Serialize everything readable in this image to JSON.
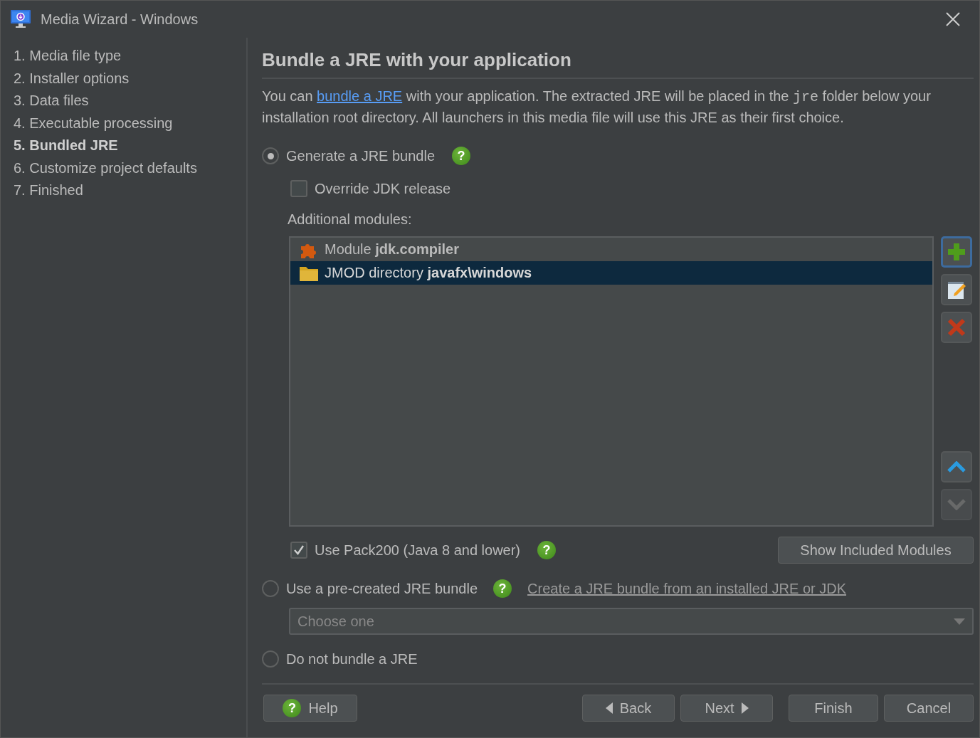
{
  "window": {
    "title": "Media Wizard - Windows"
  },
  "steps": [
    {
      "label": "1. Media file type",
      "selected": false
    },
    {
      "label": "2. Installer options",
      "selected": false
    },
    {
      "label": "3. Data files",
      "selected": false
    },
    {
      "label": "4. Executable processing",
      "selected": false
    },
    {
      "label": "5. Bundled JRE",
      "selected": true
    },
    {
      "label": "6. Customize project defaults",
      "selected": false
    },
    {
      "label": "7. Finished",
      "selected": false
    }
  ],
  "page": {
    "heading": "Bundle a JRE with your application",
    "intro": [
      {
        "kind": "text",
        "text": "You can "
      },
      {
        "kind": "link",
        "text": "bundle a JRE"
      },
      {
        "kind": "text",
        "text": " with your application. The extracted JRE will be placed in the "
      },
      {
        "kind": "code",
        "text": "jre"
      },
      {
        "kind": "text",
        "text": " folder below your installation root directory. All launchers in this media file will use this JRE as their first choice."
      }
    ],
    "generate": {
      "label": "Generate a JRE bundle",
      "selected": true,
      "help": "?"
    },
    "override": {
      "label": "Override JDK release",
      "checked": false
    },
    "modules_label": "Additional modules:",
    "modules": [
      {
        "kind": "module",
        "text": "Module **jdk.compiler**",
        "selected": false
      },
      {
        "kind": "jmod",
        "text": "JMOD directory **javafx\\windows**",
        "selected": true
      }
    ],
    "tool_buttons": [
      {
        "kind": "add",
        "focused": true,
        "disabled": false
      },
      {
        "kind": "edit",
        "focused": false,
        "disabled": false
      },
      {
        "kind": "remove",
        "focused": false,
        "disabled": false
      },
      {
        "kind": "up",
        "focused": false,
        "disabled": false
      },
      {
        "kind": "down",
        "focused": false,
        "disabled": true
      }
    ],
    "pack200": {
      "label": "Use Pack200 (Java 8 and lower)",
      "checked": true,
      "help": "?"
    },
    "show_modules": "Show Included Modules",
    "precreated": {
      "label": "Use a pre-created JRE bundle",
      "selected": false,
      "help": "?",
      "link": "Create a JRE bundle from an installed JRE or JDK"
    },
    "choose": {
      "placeholder": "Choose one"
    },
    "no_bundle": {
      "label": "Do not bundle a JRE",
      "selected": false
    }
  },
  "footer": {
    "help": {
      "label": "Help",
      "icon": "?"
    },
    "back": "Back",
    "next": "Next",
    "finish": "Finish",
    "cancel": "Cancel"
  }
}
